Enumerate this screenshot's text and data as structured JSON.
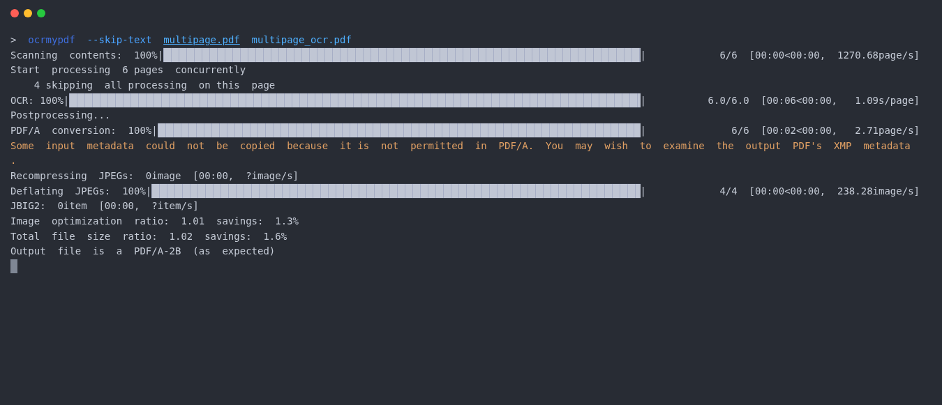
{
  "window": {
    "controls": [
      {
        "kind": "close"
      },
      {
        "kind": "minimize"
      },
      {
        "kind": "zoom"
      }
    ]
  },
  "lines": [
    {
      "kind": "command",
      "tokens": [
        {
          "kind": "prompt",
          "text": ">"
        },
        {
          "kind": "program",
          "text": "ocrmypdf"
        },
        {
          "kind": "flag",
          "text": "--skip-text"
        },
        {
          "kind": "path",
          "text": "multipage.pdf"
        },
        {
          "kind": "arg",
          "text": "multipage_ocr.pdf"
        }
      ]
    },
    {
      "kind": "progress",
      "label": "Scanning  contents:  100%|",
      "level": 1,
      "end": "|",
      "stats": "6/6  [00:00<00:00,  1270.68page/s]"
    },
    {
      "kind": "text",
      "text": "Start  processing  6 pages  concurrently"
    },
    {
      "kind": "text",
      "text": "    4 skipping  all processing  on this  page"
    },
    {
      "kind": "progress",
      "label": "OCR: 100%|",
      "level": 1,
      "end": "|",
      "stats": "6.0/6.0  [00:06<00:00,   1.09s/page]"
    },
    {
      "kind": "text",
      "text": "Postprocessing..."
    },
    {
      "kind": "progress",
      "label": "PDF/A  conversion:  100%|",
      "level": 1,
      "end": "|",
      "stats": "6/6  [00:02<00:00,   2.71page/s]"
    },
    {
      "kind": "warning",
      "text": "Some  input  metadata  could  not  be  copied  because  it is  not  permitted  in  PDF/A.  You  may  wish  to  examine  the  output  PDF's  XMP  metadata"
    },
    {
      "kind": "warning",
      "text": "."
    },
    {
      "kind": "text",
      "text": "Recompressing  JPEGs:  0image  [00:00,  ?image/s]"
    },
    {
      "kind": "progress",
      "label": "Deflating  JPEGs:  100%|",
      "level": 1,
      "end": "|",
      "stats": "4/4  [00:00<00:00,  238.28image/s]"
    },
    {
      "kind": "text",
      "text": "JBIG2:  0item  [00:00,  ?item/s]"
    },
    {
      "kind": "text",
      "text": "Image  optimization  ratio:  1.01  savings:  1.3%"
    },
    {
      "kind": "text",
      "text": "Total  file  size  ratio:  1.02  savings:  1.6%"
    },
    {
      "kind": "text",
      "text": "Output  file  is  a  PDF/A-2B  (as  expected)"
    },
    {
      "kind": "cursor"
    }
  ]
}
